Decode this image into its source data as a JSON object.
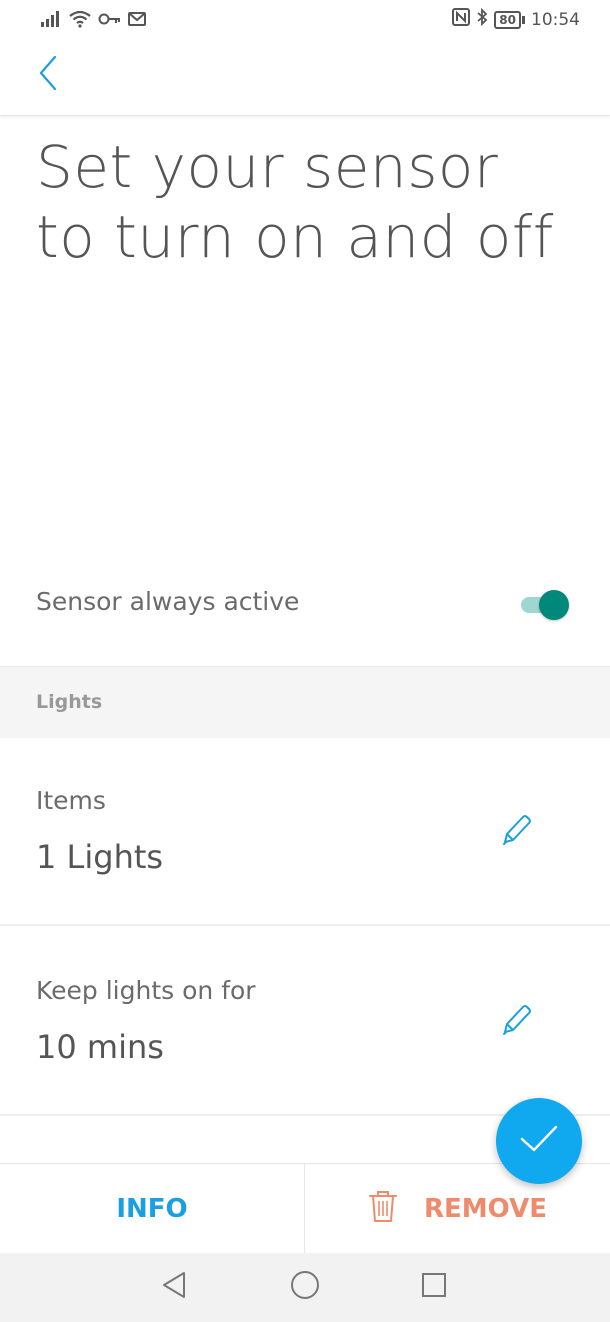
{
  "status_bar": {
    "time": "10:54",
    "battery": "80",
    "icons": [
      "signal-icon",
      "wifi-icon",
      "vpn-key-icon",
      "gmail-icon",
      "nfc-icon",
      "bluetooth-icon",
      "battery-icon"
    ]
  },
  "app_bar": {
    "back_icon": "chevron-left-icon"
  },
  "page": {
    "title": "Set your sensor to turn on and off"
  },
  "sensor_toggle": {
    "label": "Sensor always active",
    "on": true,
    "track_color": "#9fd6cf",
    "thumb_color": "#00897b"
  },
  "section": {
    "title": "Lights"
  },
  "items": [
    {
      "label": "Items",
      "value": "1 Lights",
      "icon": "pencil-icon"
    },
    {
      "label": "Keep lights on for",
      "value": "10 mins",
      "icon": "pencil-icon"
    }
  ],
  "actions": {
    "info_label": "INFO",
    "remove_label": "REMOVE",
    "confirm_icon": "checkmark-icon",
    "remove_icon": "trash-icon"
  },
  "colors": {
    "accent": "#10a8ef",
    "info": "#1a9fe0",
    "remove": "#f08a6c",
    "toggle_on": "#00897b"
  },
  "nav_bar": {
    "icons": [
      "back-triangle-icon",
      "home-circle-icon",
      "recents-square-icon"
    ]
  }
}
